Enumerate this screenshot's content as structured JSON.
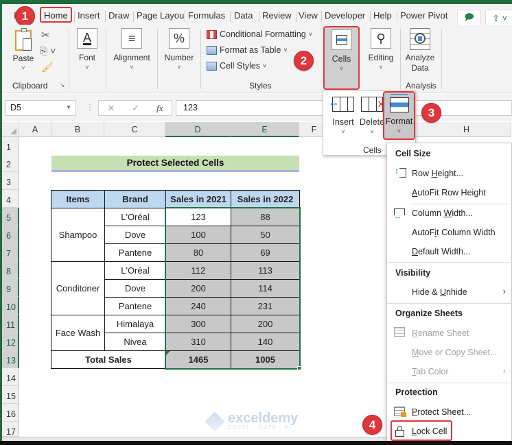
{
  "tabs": [
    {
      "label": "Home",
      "active": true
    },
    {
      "label": "Insert"
    },
    {
      "label": "Draw"
    },
    {
      "label": "Page Layou"
    },
    {
      "label": "Formulas"
    },
    {
      "label": "Data"
    },
    {
      "label": "Review"
    },
    {
      "label": "View"
    },
    {
      "label": "Developer"
    },
    {
      "label": "Help"
    },
    {
      "label": "Power Pivot"
    }
  ],
  "tab_buttons": {
    "comment_icon": "comment-icon",
    "share_icon": "share-icon"
  },
  "ribbon": {
    "clipboard": {
      "paste": "Paste",
      "group": "Clipboard"
    },
    "font": {
      "label": "Font",
      "icon": "A"
    },
    "alignment": {
      "label": "Alignment",
      "icon": "≡"
    },
    "number": {
      "label": "Number",
      "icon": "%"
    },
    "styles": {
      "conditional": "Conditional Formatting",
      "format_table": "Format as Table",
      "cell_styles": "Cell Styles",
      "group": "Styles"
    },
    "cells": {
      "label": "Cells"
    },
    "editing": {
      "label": "Editing"
    },
    "analysis": {
      "analyze_line1": "Analyze",
      "analyze_line2": "Data",
      "group": "Analysis"
    }
  },
  "formula_bar": {
    "name_box": "D5",
    "cancel": "✕",
    "enter": "✓",
    "fx": "fx",
    "formula": "123"
  },
  "columns": [
    "A",
    "B",
    "C",
    "D",
    "E",
    "F",
    "H"
  ],
  "rows": [
    "1",
    "2",
    "3",
    "4",
    "5",
    "6",
    "7",
    "8",
    "9",
    "10",
    "11",
    "12",
    "13",
    "14",
    "15",
    "16",
    "17"
  ],
  "sheet": {
    "title": "Protect Selected Cells",
    "headers": [
      "Items",
      "Brand",
      "Sales in 2021",
      "Sales in 2022"
    ],
    "groups": [
      {
        "item": "Shampoo",
        "rows": [
          {
            "brand": "L'Oréal",
            "s2021": "123",
            "s2022": "88"
          },
          {
            "brand": "Dove",
            "s2021": "100",
            "s2022": "50"
          },
          {
            "brand": "Pantene",
            "s2021": "80",
            "s2022": "69"
          }
        ]
      },
      {
        "item": "Conditoner",
        "rows": [
          {
            "brand": "L'Oréal",
            "s2021": "112",
            "s2022": "113"
          },
          {
            "brand": "Dove",
            "s2021": "200",
            "s2022": "114"
          },
          {
            "brand": "Pantene",
            "s2021": "240",
            "s2022": "231"
          }
        ]
      },
      {
        "item": "Face Wash",
        "rows": [
          {
            "brand": "Himalaya",
            "s2021": "300",
            "s2022": "200"
          },
          {
            "brand": "Nivea",
            "s2021": "310",
            "s2022": "140"
          }
        ]
      }
    ],
    "total": {
      "label": "Total Sales",
      "s2021": "1465",
      "s2022": "1005"
    }
  },
  "cells_dropdown": {
    "insert": "Insert",
    "delete": "Delete",
    "format": "Format",
    "group": "Cells"
  },
  "format_menu": {
    "cell_size": "Cell Size",
    "row_height": "Row Height...",
    "autofit_row": "AutoFit Row Height",
    "column_width": "Column Width...",
    "autofit_column": "AutoFit Column Width",
    "default_width": "Default Width...",
    "visibility": "Visibility",
    "hide_unhide": "Hide & Unhide",
    "organize": "Organize Sheets",
    "rename": "Rename Sheet",
    "move_copy": "Move or Copy Sheet...",
    "tab_color": "Tab Color",
    "protection": "Protection",
    "protect_sheet": "Protect Sheet...",
    "lock_cell": "Lock Cell"
  },
  "steps": [
    "1",
    "2",
    "3",
    "4"
  ],
  "watermark": {
    "brand": "exceldemy",
    "tagline": "EXCEL · DATA · BI"
  },
  "colors": {
    "accent_red": "#e0373c",
    "excel_green": "#217346",
    "header_blue": "#bdd7ee",
    "title_green": "#c6e0b4",
    "locked_gray": "#c8c8c8"
  }
}
